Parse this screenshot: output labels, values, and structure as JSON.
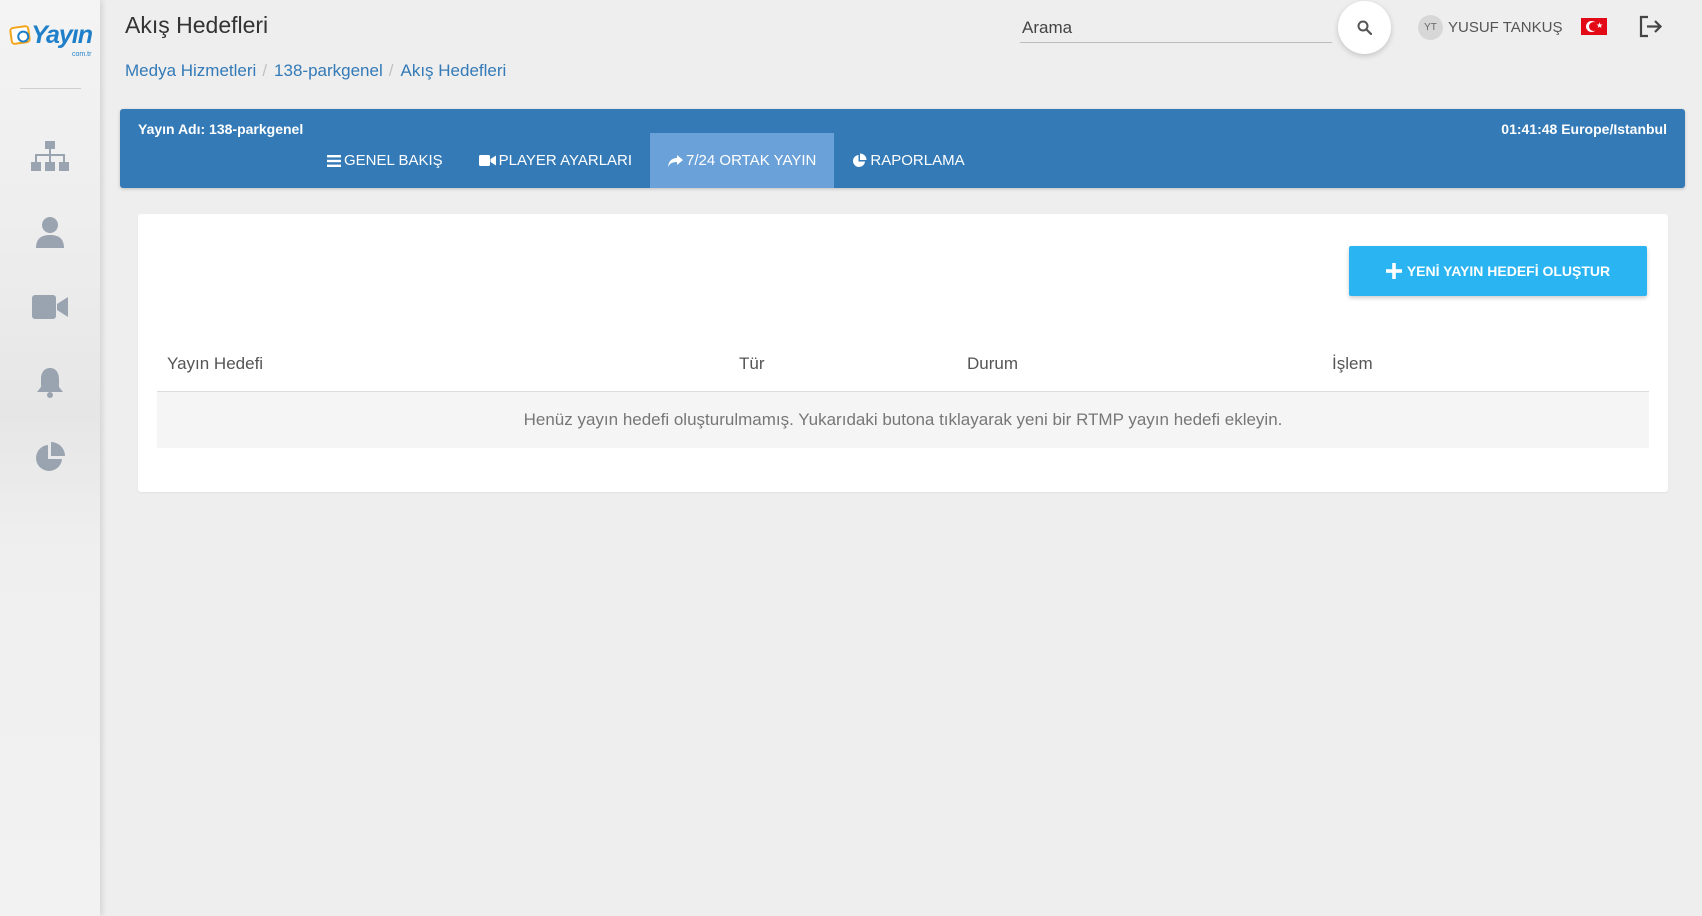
{
  "brand": {
    "logo_text": "Yayın",
    "logo_sub": "com.tr"
  },
  "sidebar": {
    "items": [
      {
        "icon": "sitemap-icon"
      },
      {
        "icon": "user-icon"
      },
      {
        "icon": "video-camera-icon"
      },
      {
        "icon": "bell-icon"
      },
      {
        "icon": "pie-chart-icon"
      }
    ]
  },
  "header": {
    "title": "Akış Hedefleri",
    "search_placeholder": "Arama",
    "user_initials": "YT",
    "user_name": "YUSUF TANKUŞ",
    "language_flag": "turkey-flag-icon"
  },
  "breadcrumb": [
    "Medya Hizmetleri",
    "138-parkgenel",
    "Akış Hedefleri"
  ],
  "stream_bar": {
    "stream_name": "Yayın Adı: 138-parkgenel",
    "time": "01:41:48 Europe/Istanbul",
    "tabs": [
      {
        "label": "GENEL BAKIŞ",
        "icon": "list-icon",
        "active": false
      },
      {
        "label": "PLAYER AYARLARI",
        "icon": "video-camera-icon",
        "active": false
      },
      {
        "label": "7/24 ORTAK YAYIN",
        "icon": "share-icon",
        "active": true
      },
      {
        "label": "RAPORLAMA",
        "icon": "pie-chart-icon",
        "active": false
      }
    ]
  },
  "content": {
    "new_button_label": "YENİ YAYIN HEDEFİ OLUŞTUR",
    "columns": [
      "Yayın Hedefi",
      "Tür",
      "Durum",
      "İşlem"
    ],
    "empty_message": "Henüz yayın hedefi oluşturulmamış. Yukarıdaki butona tıklayarak yeni bir RTMP yayın hedefi ekleyin."
  },
  "colors": {
    "primary_blue": "#337ab7",
    "active_tab": "#6aa1d9",
    "button_cyan": "#2ab5f2",
    "icon_gray": "#9aa4b0"
  }
}
